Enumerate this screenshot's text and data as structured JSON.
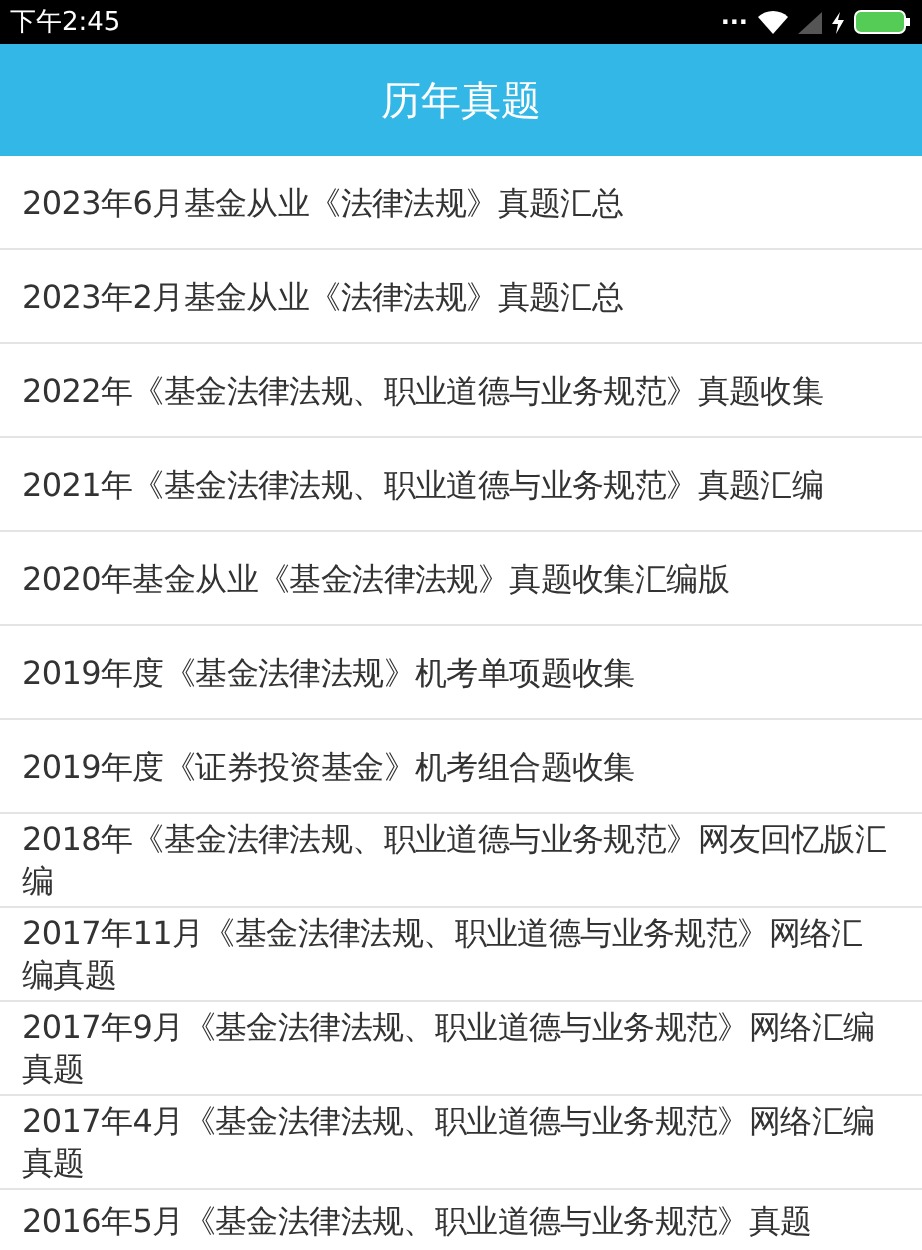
{
  "status_bar": {
    "time": "下午2:45",
    "more": "..."
  },
  "header": {
    "title": "历年真题"
  },
  "items": [
    {
      "label": "2023年6月基金从业《法律法规》真题汇总"
    },
    {
      "label": "2023年2月基金从业《法律法规》真题汇总"
    },
    {
      "label": "2022年《基金法律法规、职业道德与业务规范》真题收集"
    },
    {
      "label": "2021年《基金法律法规、职业道德与业务规范》真题汇编"
    },
    {
      "label": "2020年基金从业《基金法律法规》真题收集汇编版"
    },
    {
      "label": "2019年度《基金法律法规》机考单项题收集"
    },
    {
      "label": "2019年度《证券投资基金》机考组合题收集"
    },
    {
      "label": "2018年《基金法律法规、职业道德与业务规范》网友回忆版汇编"
    },
    {
      "label": "2017年11月《基金法律法规、职业道德与业务规范》网络汇编真题"
    },
    {
      "label": "2017年9月《基金法律法规、职业道德与业务规范》网络汇编真题"
    },
    {
      "label": "2017年4月《基金法律法规、职业道德与业务规范》网络汇编真题"
    },
    {
      "label": "2016年5月《基金法律法规、职业道德与业务规范》真题"
    }
  ]
}
